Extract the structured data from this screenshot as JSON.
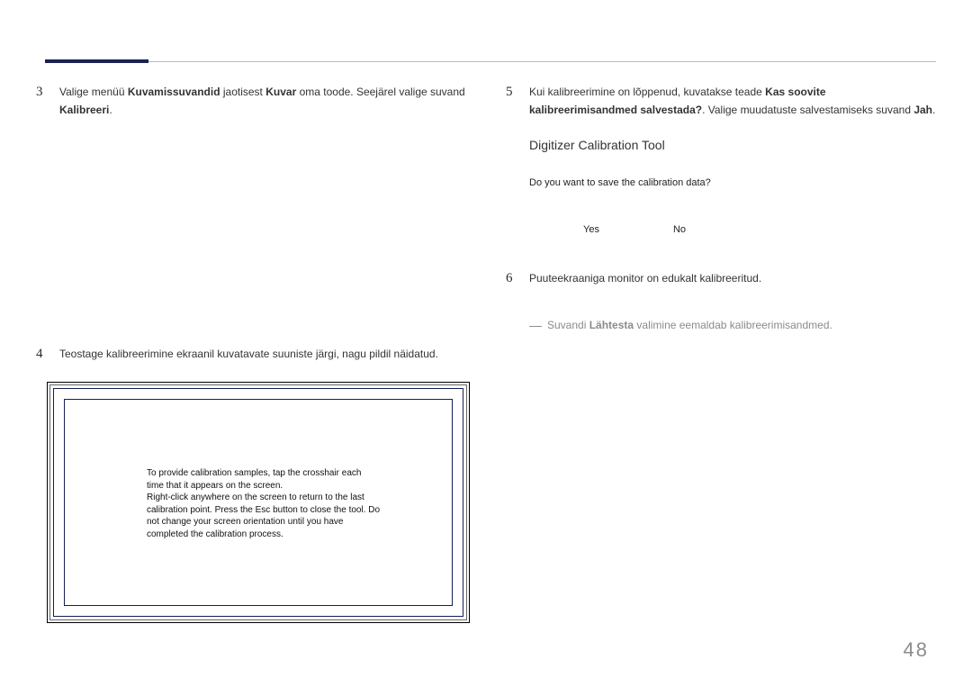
{
  "page_number": "48",
  "left": {
    "step3": {
      "num": "3",
      "pre": "Valige menüü ",
      "b1": "Kuvamissuvandid",
      "mid1": " jaotisest ",
      "b2": "Kuvar",
      "mid2": " oma toode. Seejärel valige suvand ",
      "b3": "Kalibreeri",
      "post": "."
    },
    "step4": {
      "num": "4",
      "text": "Teostage kalibreerimine ekraanil kuvatavate suuniste järgi, nagu pildil näidatud."
    },
    "calib_text": "To provide calibration samples, tap the crosshair each time that it appears on the screen.\nRight-click anywhere on the screen to return to the last calibration point. Press the Esc button to close the tool. Do not change your screen orientation until you have completed the calibration process."
  },
  "right": {
    "step5": {
      "num": "5",
      "pre": "Kui kalibreerimine on lõppenud, kuvatakse teade ",
      "b1": "Kas soovite kalibreerimisandmed salvestada?",
      "mid": ". Valige muudatuste salvestamiseks suvand ",
      "b2": "Jah",
      "post": "."
    },
    "dialog": {
      "title": "Digitizer Calibration Tool",
      "message": "Do you want to save the calibration data?",
      "yes": "Yes",
      "no": "No"
    },
    "step6": {
      "num": "6",
      "text": "Puuteekraaniga monitor on edukalt kalibreeritud."
    },
    "note": {
      "dash": "―",
      "pre": "Suvandi ",
      "b": "Lähtesta",
      "post": " valimine eemaldab kalibreerimisandmed."
    }
  }
}
